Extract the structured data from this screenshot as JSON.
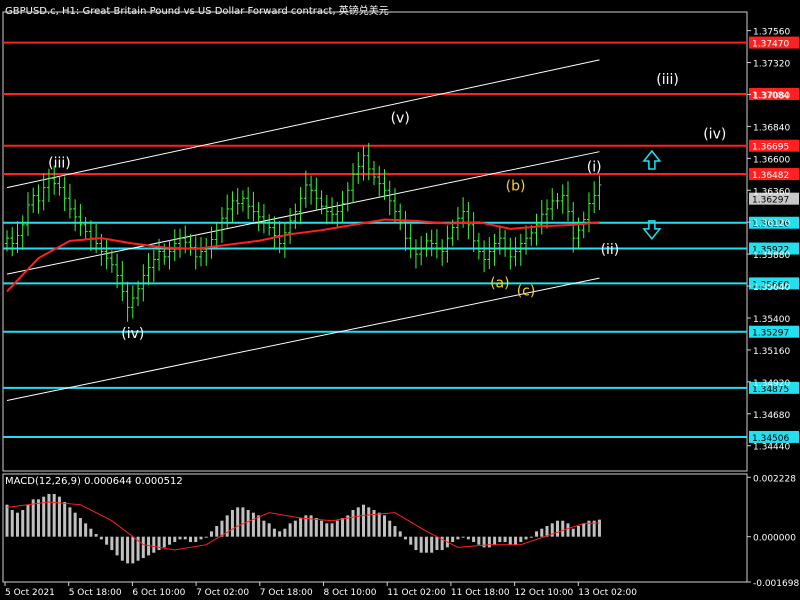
{
  "window": {
    "title": "GBPUSD.c, H1:  Great Britain Pound vs US Dollar Forward contract, 英镑兑美元"
  },
  "colors": {
    "background": "#000000",
    "candle": "#33ff33",
    "ma": "#ff2020",
    "resistance": "#ff2020",
    "support": "#22e0f0",
    "channel": "#ffffff",
    "wave_white": "#ffffff",
    "wave_yellow": "#ffd21a",
    "macd_hist": "#c0c0c0",
    "macd_signal": "#ff2020",
    "arrow": "#22e0f0"
  },
  "chart_data": [
    {
      "type": "candlestick",
      "title": "GBPUSD.c, H1:  Great Britain Pound vs US Dollar Forward contract, 英镑兑美元",
      "ylim": [
        1.3425,
        1.377
      ],
      "y_ticks": [
        "1.37560",
        "1.37320",
        "1.37080",
        "1.36840",
        "1.36600",
        "1.36360",
        "1.36120",
        "1.35880",
        "1.35640",
        "1.35400",
        "1.35160",
        "1.34920",
        "1.34680",
        "1.34440"
      ],
      "x_ticks": [
        "5 Oct 2021",
        "5 Oct 18:00",
        "6 Oct 10:00",
        "7 Oct 02:00",
        "7 Oct 18:00",
        "8 Oct 10:00",
        "11 Oct 02:00",
        "11 Oct 18:00",
        "12 Oct 10:00",
        "13 Oct 02:00"
      ],
      "close_series": [
        1.36,
        1.3596,
        1.3602,
        1.361,
        1.3625,
        1.3632,
        1.3628,
        1.3638,
        1.3645,
        1.3641,
        1.3638,
        1.363,
        1.3622,
        1.3616,
        1.361,
        1.3605,
        1.36,
        1.3596,
        1.359,
        1.3585,
        1.358,
        1.3572,
        1.356,
        1.3548,
        1.3555,
        1.3562,
        1.3572,
        1.3578,
        1.3584,
        1.359,
        1.3586,
        1.359,
        1.3596,
        1.36,
        1.3597,
        1.3593,
        1.3586,
        1.359,
        1.3593,
        1.3599,
        1.3606,
        1.3615,
        1.3622,
        1.3628,
        1.3626,
        1.363,
        1.3624,
        1.362,
        1.3616,
        1.3612,
        1.3608,
        1.3602,
        1.3596,
        1.3604,
        1.3613,
        1.362,
        1.363,
        1.364,
        1.3636,
        1.363,
        1.3624,
        1.362,
        1.3618,
        1.362,
        1.3626,
        1.3636,
        1.3648,
        1.3654,
        1.3662,
        1.3652,
        1.3646,
        1.3641,
        1.3636,
        1.3628,
        1.362,
        1.3612,
        1.36,
        1.3592,
        1.3588,
        1.3592,
        1.3598,
        1.3596,
        1.3592,
        1.359,
        1.36,
        1.3608,
        1.3615,
        1.362,
        1.361,
        1.3598,
        1.359,
        1.3584,
        1.359,
        1.3596,
        1.36,
        1.3592,
        1.3586,
        1.359,
        1.3596,
        1.36,
        1.3604,
        1.361,
        1.3618,
        1.3622,
        1.3628,
        1.3628,
        1.3632,
        1.362,
        1.36,
        1.3606,
        1.3614,
        1.3626,
        1.3632,
        1.364
      ],
      "key_levels": [
        {
          "label": "1.37470",
          "value": 1.3747,
          "kind": "resistance"
        },
        {
          "label": "1.37084",
          "value": 1.37084,
          "kind": "resistance"
        },
        {
          "label": "1.36695",
          "value": 1.36695,
          "kind": "resistance"
        },
        {
          "label": "1.36482",
          "value": 1.36482,
          "kind": "resistance"
        },
        {
          "label": "1.36116",
          "value": 1.36116,
          "kind": "support"
        },
        {
          "label": "1.35922",
          "value": 1.35922,
          "kind": "support"
        },
        {
          "label": "1.35660",
          "value": 1.3566,
          "kind": "support"
        },
        {
          "label": "1.35297",
          "value": 1.35297,
          "kind": "support"
        },
        {
          "label": "1.34875",
          "value": 1.34875,
          "kind": "support"
        },
        {
          "label": "1.34506",
          "value": 1.34506,
          "kind": "support"
        }
      ],
      "current_price": {
        "label": "1.36297",
        "value": 1.36297
      },
      "moving_average": [
        [
          0,
          1.356
        ],
        [
          6,
          1.3585
        ],
        [
          12,
          1.3598
        ],
        [
          18,
          1.36
        ],
        [
          24,
          1.3596
        ],
        [
          30,
          1.3593
        ],
        [
          36,
          1.3592
        ],
        [
          42,
          1.3595
        ],
        [
          48,
          1.3598
        ],
        [
          54,
          1.3603
        ],
        [
          60,
          1.3606
        ],
        [
          66,
          1.361
        ],
        [
          72,
          1.3614
        ],
        [
          78,
          1.3613
        ],
        [
          84,
          1.3611
        ],
        [
          90,
          1.3612
        ],
        [
          96,
          1.3607
        ],
        [
          102,
          1.3609
        ],
        [
          108,
          1.361
        ],
        [
          113,
          1.3612
        ]
      ],
      "channel_lines": [
        {
          "from": [
            0,
            1.3638
          ],
          "to": [
            113,
            1.3734
          ]
        },
        {
          "from": [
            0,
            1.3573
          ],
          "to": [
            113,
            1.3665
          ]
        },
        {
          "from": [
            0,
            1.3478
          ],
          "to": [
            113,
            1.357
          ]
        }
      ],
      "wave_labels": [
        {
          "text": "(iii)",
          "bar": 10,
          "price": 1.3653,
          "color": "wave_white"
        },
        {
          "text": "(iv)",
          "bar": 24,
          "price": 1.3525,
          "color": "wave_white"
        },
        {
          "text": "(v)",
          "bar": 75,
          "price": 1.3687,
          "color": "wave_white"
        },
        {
          "text": "(b)",
          "bar": 97,
          "price": 1.3636,
          "color": "wave_yellow"
        },
        {
          "text": "(a)",
          "bar": 94,
          "price": 1.3563,
          "color": "wave_yellow"
        },
        {
          "text": "(c)",
          "bar": 99,
          "price": 1.3557,
          "color": "wave_yellow"
        },
        {
          "text": "(i)",
          "bar": 112,
          "price": 1.365,
          "color": "wave_white"
        },
        {
          "text": "(ii)",
          "bar": 115,
          "price": 1.3588,
          "color": "wave_white"
        },
        {
          "text": "(iii)",
          "bar": 126,
          "price": 1.3716,
          "color": "wave_white"
        },
        {
          "text": "(iv)",
          "bar": 135,
          "price": 1.3675,
          "color": "wave_white"
        }
      ],
      "arrows": [
        {
          "direction": "up",
          "bar": 123,
          "price": 1.3658
        },
        {
          "direction": "down",
          "bar": 123,
          "price": 1.3607
        }
      ]
    },
    {
      "type": "bar",
      "title": "MACD(12,26,9) 0.000644 0.000512",
      "ylim": [
        -0.001698,
        0.00235
      ],
      "y_ticks": [
        "0.002228",
        "0.000000",
        "-0.001698"
      ],
      "histogram": [
        0.0012,
        0.001,
        0.0009,
        0.001,
        0.0012,
        0.0014,
        0.0014,
        0.0015,
        0.0016,
        0.0016,
        0.0015,
        0.0013,
        0.0011,
        0.0009,
        0.0007,
        0.0005,
        0.0003,
        0.0001,
        -0.0001,
        -0.0003,
        -0.0005,
        -0.0007,
        -0.0009,
        -0.001,
        -0.001,
        -0.0009,
        -0.0008,
        -0.0007,
        -0.0006,
        -0.0005,
        -0.0004,
        -0.0003,
        -0.0002,
        -0.0001,
        -0.0001,
        -0.0002,
        -0.0002,
        -0.0001,
        0.0,
        0.0002,
        0.0004,
        0.0006,
        0.0008,
        0.001,
        0.0011,
        0.0011,
        0.001,
        0.0009,
        0.0008,
        0.0006,
        0.0005,
        0.0003,
        0.0002,
        0.0003,
        0.0005,
        0.0006,
        0.0007,
        0.0008,
        0.0008,
        0.0007,
        0.0006,
        0.0005,
        0.0005,
        0.0006,
        0.0007,
        0.0008,
        0.001,
        0.0011,
        0.0012,
        0.0011,
        0.001,
        0.0009,
        0.0008,
        0.0006,
        0.0004,
        0.0002,
        -0.0001,
        -0.0003,
        -0.0005,
        -0.0006,
        -0.0006,
        -0.0006,
        -0.0005,
        -0.0005,
        -0.0004,
        -0.0002,
        -0.0001,
        0.0,
        -0.0001,
        -0.0002,
        -0.0003,
        -0.0004,
        -0.0004,
        -0.0003,
        -0.0002,
        -0.0002,
        -0.0003,
        -0.0003,
        -0.0002,
        -0.0001,
        0.0,
        0.0002,
        0.0003,
        0.0004,
        0.0005,
        0.0006,
        0.0006,
        0.0005,
        0.0003,
        0.0004,
        0.0005,
        0.0006,
        0.0006,
        0.00064
      ],
      "signal": [
        [
          0,
          0.0011
        ],
        [
          8,
          0.0013
        ],
        [
          14,
          0.0012
        ],
        [
          20,
          0.0006
        ],
        [
          26,
          -0.0003
        ],
        [
          32,
          -0.0005
        ],
        [
          38,
          -0.0003
        ],
        [
          44,
          0.0004
        ],
        [
          50,
          0.0009
        ],
        [
          56,
          0.0007
        ],
        [
          62,
          0.0006
        ],
        [
          68,
          0.0008
        ],
        [
          74,
          0.0009
        ],
        [
          80,
          0.0002
        ],
        [
          86,
          -0.0004
        ],
        [
          92,
          -0.0003
        ],
        [
          98,
          -0.0003
        ],
        [
          104,
          0.0001
        ],
        [
          110,
          0.0005
        ],
        [
          113,
          0.000512
        ]
      ]
    }
  ]
}
